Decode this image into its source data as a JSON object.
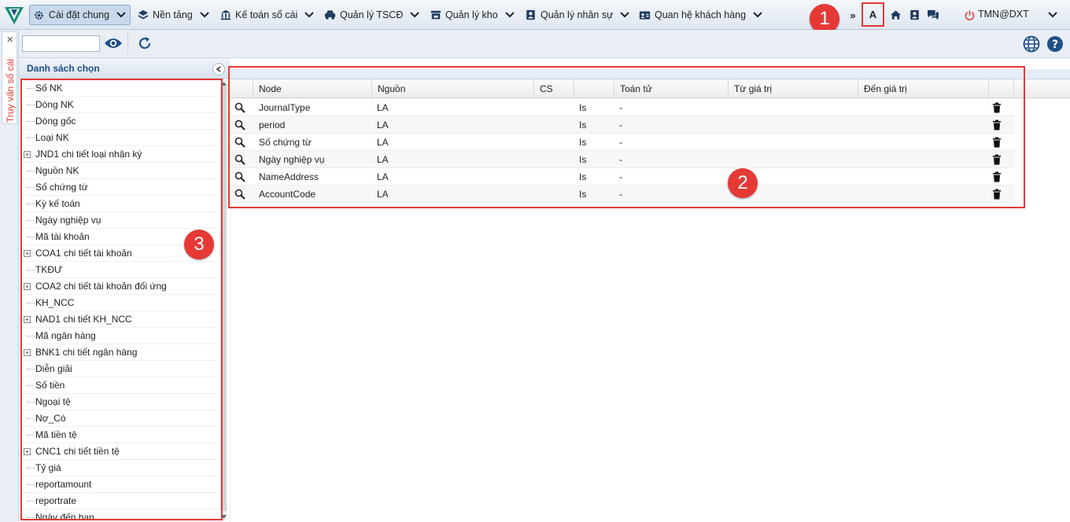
{
  "topbar": {
    "menus": [
      {
        "label": "Cài đặt chung",
        "icon": "gear-icon"
      },
      {
        "label": "Nền tảng",
        "icon": "layers-icon"
      },
      {
        "label": "Kế toán sổ cái",
        "icon": "bank-icon"
      },
      {
        "label": "Quản lý TSCĐ",
        "icon": "car-icon"
      },
      {
        "label": "Quản lý kho",
        "icon": "store-icon"
      },
      {
        "label": "Quản lý nhân sự",
        "icon": "id-badge-icon"
      },
      {
        "label": "Quan hệ khách hàng",
        "icon": "contact-card-icon"
      }
    ],
    "more_label": "»",
    "lang_label": "A",
    "user_label": "TMN@DXT"
  },
  "annotations": {
    "badge1": "1",
    "badge2": "2",
    "badge3": "3"
  },
  "toolbar": {
    "search_value": ""
  },
  "side_tab": {
    "label": "Truy vấn sổ cái",
    "close": "✕"
  },
  "left_panel": {
    "title": "Danh sách chọn",
    "items": [
      {
        "label": "Số NK",
        "expandable": false
      },
      {
        "label": "Dòng NK",
        "expandable": false
      },
      {
        "label": "Dòng gốc",
        "expandable": false
      },
      {
        "label": "Loại NK",
        "expandable": false
      },
      {
        "label": "JND1 chi tiết loại nhận ký",
        "expandable": true
      },
      {
        "label": "Nguồn NK",
        "expandable": false
      },
      {
        "label": "Số chứng từ",
        "expandable": false
      },
      {
        "label": "Kỳ kế toán",
        "expandable": false
      },
      {
        "label": "Ngày nghiệp vụ",
        "expandable": false
      },
      {
        "label": "Mã tài khoản",
        "expandable": false
      },
      {
        "label": "COA1 chi tiết tài khoản",
        "expandable": true
      },
      {
        "label": "TKĐƯ",
        "expandable": false
      },
      {
        "label": "COA2 chi tiết tài khoản đối ứng",
        "expandable": true
      },
      {
        "label": "KH_NCC",
        "expandable": false
      },
      {
        "label": "NAD1 chi tiết KH_NCC",
        "expandable": true
      },
      {
        "label": "Mã ngân hàng",
        "expandable": false
      },
      {
        "label": "BNK1 chi tiết ngân hàng",
        "expandable": true
      },
      {
        "label": "Diễn giải",
        "expandable": false
      },
      {
        "label": "Số tiền",
        "expandable": false
      },
      {
        "label": "Ngoại tệ",
        "expandable": false
      },
      {
        "label": "Nợ_Có",
        "expandable": false
      },
      {
        "label": "Mã tiền tệ",
        "expandable": false
      },
      {
        "label": "CNC1 chi tiết tiền tệ",
        "expandable": true
      },
      {
        "label": "Tỷ giá",
        "expandable": false
      },
      {
        "label": "reportamount",
        "expandable": false
      },
      {
        "label": "reportrate",
        "expandable": false
      },
      {
        "label": "Ngày đến hạn",
        "expandable": false
      }
    ]
  },
  "grid": {
    "columns": [
      "Node",
      "Nguồn",
      "CS",
      "",
      "Toán tử",
      "Từ giá trị",
      "Đến giá trị"
    ],
    "rows": [
      {
        "node": "JournalType",
        "source": "LA",
        "cs": "",
        "op1": "Is",
        "operator": "-",
        "from": "",
        "to": ""
      },
      {
        "node": "period",
        "source": "LA",
        "cs": "",
        "op1": "Is",
        "operator": "-",
        "from": "",
        "to": ""
      },
      {
        "node": "Số chứng từ",
        "source": "LA",
        "cs": "",
        "op1": "Is",
        "operator": "-",
        "from": "",
        "to": ""
      },
      {
        "node": "Ngày nghiệp vụ",
        "source": "LA",
        "cs": "",
        "op1": "Is",
        "operator": "-",
        "from": "",
        "to": ""
      },
      {
        "node": "NameAddress",
        "source": "LA",
        "cs": "",
        "op1": "Is",
        "operator": "-",
        "from": "",
        "to": ""
      },
      {
        "node": "AccountCode",
        "source": "LA",
        "cs": "",
        "op1": "Is",
        "operator": "-",
        "from": "",
        "to": ""
      }
    ]
  },
  "colors": {
    "accent": "#1f4f86",
    "annotation": "#e53935",
    "power": "#e53935"
  }
}
